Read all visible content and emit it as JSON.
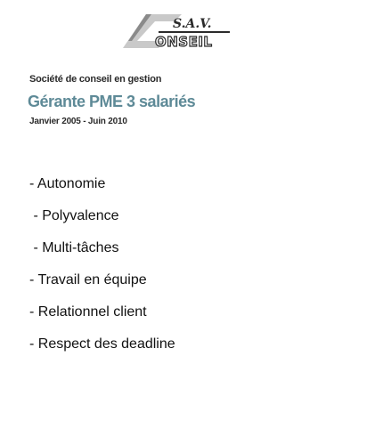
{
  "logo": {
    "top_text": "S.A.V.",
    "bottom_text": "ONSEIL",
    "letter": "C",
    "colors": {
      "dark": "#2b2b2b",
      "light": "#c9c9c9",
      "mid": "#8a8a8a"
    }
  },
  "company": "Société de conseil en gestion",
  "role": "Gérante PME 3 salariés",
  "dates": "Janvier 2005 - Juin 2010",
  "skills": [
    "- Autonomie",
    " - Polyvalence",
    " - Multi-tâches",
    "- Travail en équipe",
    "- Relationnel client",
    "- Respect des deadline"
  ],
  "colors": {
    "role_accent": "#5e8a97",
    "text": "#1a1a1a"
  }
}
